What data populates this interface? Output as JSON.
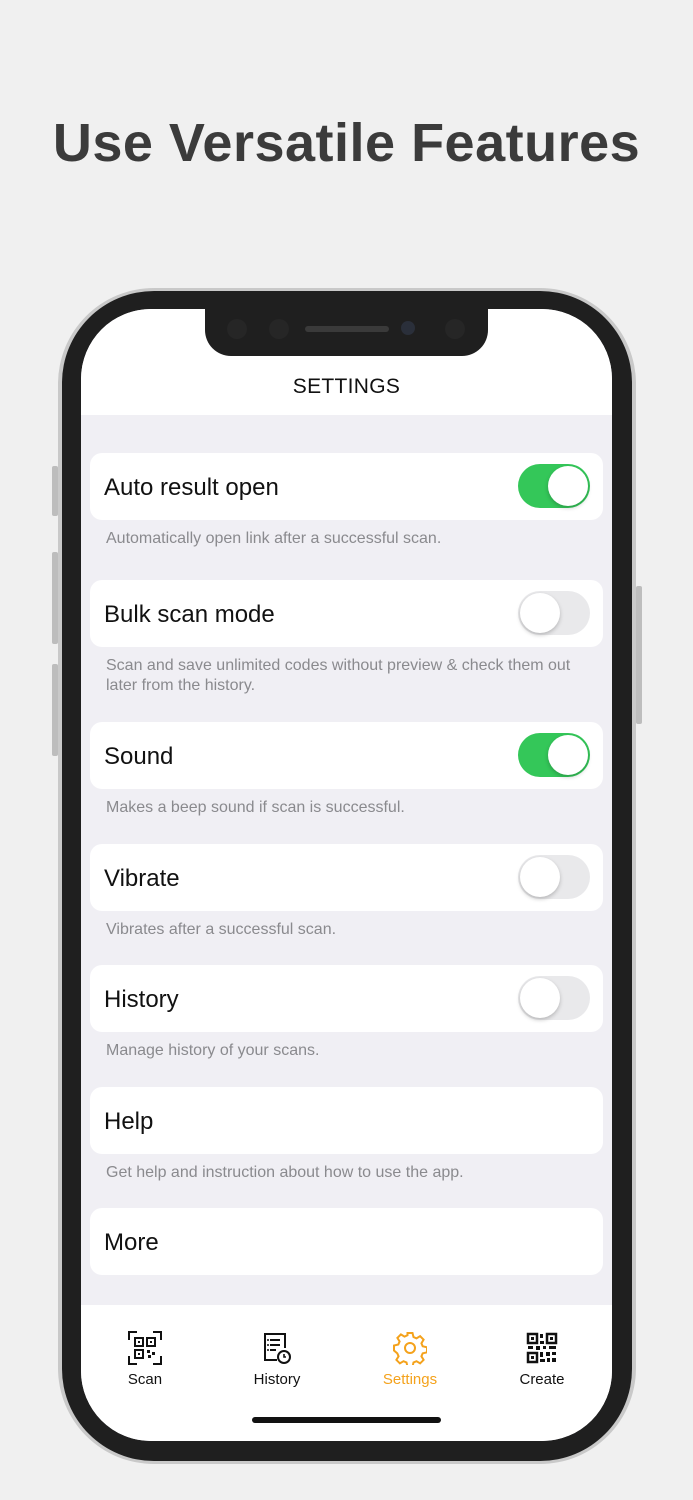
{
  "headline": "Use Versatile Features",
  "nav": {
    "title": "SETTINGS"
  },
  "settings": [
    {
      "label": "Auto result open",
      "toggle": true,
      "on": true,
      "description": "Automatically open link  after a successful scan."
    },
    {
      "label": "Bulk scan mode",
      "toggle": true,
      "on": false,
      "description": "Scan and save unlimited codes without preview & check them out later from the history."
    },
    {
      "label": "Sound",
      "toggle": true,
      "on": true,
      "description": "Makes a beep sound if scan is successful."
    },
    {
      "label": "Vibrate",
      "toggle": true,
      "on": false,
      "description": "Vibrates after a successful scan."
    },
    {
      "label": "History",
      "toggle": true,
      "on": false,
      "description": "Manage history of your scans."
    },
    {
      "label": "Help",
      "toggle": false,
      "description": "Get help and instruction about how to use the app."
    },
    {
      "label": "More",
      "toggle": false
    }
  ],
  "tabs": [
    {
      "label": "Scan",
      "icon": "scan-icon",
      "active": false
    },
    {
      "label": "History",
      "icon": "history-icon",
      "active": false
    },
    {
      "label": "Settings",
      "icon": "gear-icon",
      "active": true
    },
    {
      "label": "Create",
      "icon": "qr-code-icon",
      "active": false
    }
  ],
  "colors": {
    "toggle_on": "#34c759",
    "toggle_off": "#e9e9eb",
    "accent": "#f4a21c"
  }
}
